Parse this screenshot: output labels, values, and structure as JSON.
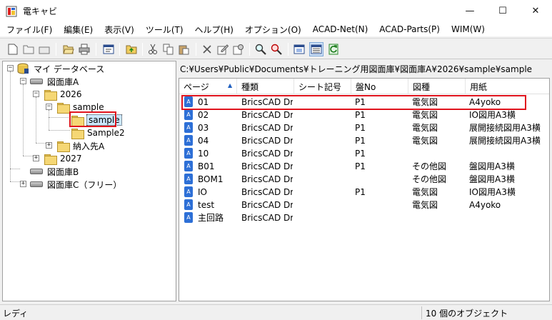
{
  "window": {
    "title": "電キャビ"
  },
  "window_controls": {
    "minimize": "—",
    "maximize": "☐",
    "close": "✕"
  },
  "menu": [
    "ファイル(F)",
    "編集(E)",
    "表示(V)",
    "ツール(T)",
    "ヘルプ(H)",
    "オプション(O)",
    "ACAD-Net(N)",
    "ACAD-Parts(P)",
    "WIM(W)"
  ],
  "toolbar": {
    "buttons": [
      "new-icon",
      "open-icon",
      "close-folder-icon",
      "open-folder-icon",
      "print-icon",
      "properties-icon",
      "up-folder-icon",
      "cut-icon",
      "copy-icon",
      "paste-icon",
      "delete-icon",
      "edit-icon",
      "settings-icon",
      "search-icon",
      "search-replace-icon",
      "view-large-icon",
      "view-details-icon",
      "refresh-icon"
    ]
  },
  "tree": {
    "root": "マイ データベース",
    "db_a": "図面庫A",
    "y2026": "2026",
    "sample": "sample",
    "sample_sel": "sample",
    "sample2": "Sample2",
    "nounyu": "納入先A",
    "y2027": "2027",
    "db_b": "図面庫B",
    "db_c": "図面庫C（フリー）"
  },
  "path": "C:¥Users¥Public¥Documents¥トレーニング用図面庫¥図面庫A¥2026¥sample¥sample",
  "list": {
    "columns": [
      "ページ",
      "種類",
      "シート記号",
      "盤No",
      "図種",
      "用紙"
    ],
    "rows": [
      {
        "page": "01",
        "type": "BricsCAD Draw",
        "sheet": "",
        "ban": "P1",
        "zushu": "電気図",
        "paper": "A4yoko"
      },
      {
        "page": "02",
        "type": "BricsCAD Draw",
        "sheet": "",
        "ban": "P1",
        "zushu": "電気図",
        "paper": "IO図用A3横"
      },
      {
        "page": "03",
        "type": "BricsCAD Draw",
        "sheet": "",
        "ban": "P1",
        "zushu": "電気図",
        "paper": "展開接続図用A3横"
      },
      {
        "page": "04",
        "type": "BricsCAD Draw",
        "sheet": "",
        "ban": "P1",
        "zushu": "電気図",
        "paper": "展開接続図用A3横"
      },
      {
        "page": "10",
        "type": "BricsCAD Draw",
        "sheet": "",
        "ban": "P1",
        "zushu": "",
        "paper": ""
      },
      {
        "page": "B01",
        "type": "BricsCAD Draw",
        "sheet": "",
        "ban": "P1",
        "zushu": "その他図",
        "paper": "盤図用A3横"
      },
      {
        "page": "BOM1",
        "type": "BricsCAD Draw",
        "sheet": "",
        "ban": "",
        "zushu": "その他図",
        "paper": "盤図用A3横"
      },
      {
        "page": "IO",
        "type": "BricsCAD Draw",
        "sheet": "",
        "ban": "P1",
        "zushu": "電気図",
        "paper": "IO図用A3横"
      },
      {
        "page": "test",
        "type": "BricsCAD Draw",
        "sheet": "",
        "ban": "",
        "zushu": "電気図",
        "paper": "A4yoko"
      },
      {
        "page": "主回路",
        "type": "BricsCAD Draw",
        "sheet": "",
        "ban": "",
        "zushu": "",
        "paper": ""
      }
    ]
  },
  "status": {
    "left": "レディ",
    "right": "10 個のオブジェクト"
  },
  "colors": {
    "highlight": "#e0141e",
    "file_icon": "#2d6fd6",
    "selection": "#cce8ff"
  }
}
